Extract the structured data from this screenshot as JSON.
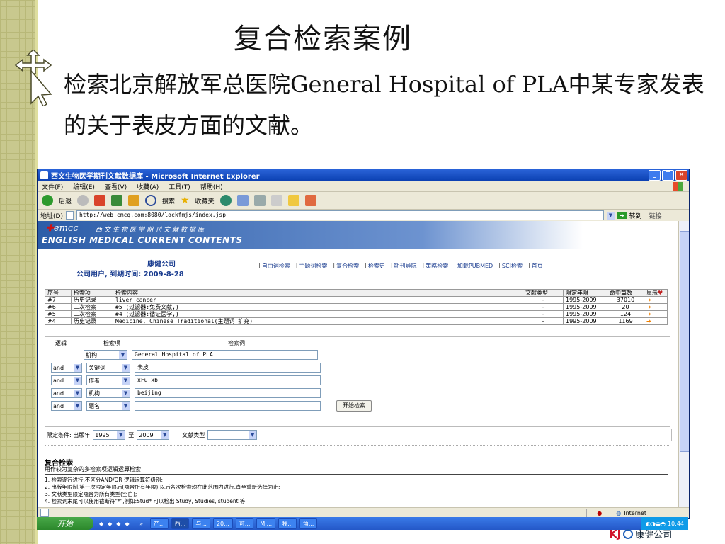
{
  "slide": {
    "title": "复合检索案例",
    "body": "检索北京解放军总医院General Hospital of PLA中某专家发表的关于表皮方面的文献。"
  },
  "browser": {
    "window_title": "西文生物医学期刊文献数据库 - Microsoft Internet Explorer",
    "menu": [
      "文件(F)",
      "编辑(E)",
      "查看(V)",
      "收藏(A)",
      "工具(T)",
      "帮助(H)"
    ],
    "toolbar": {
      "back": "后退",
      "search": "搜索",
      "favorites": "收藏夹"
    },
    "address_label": "地址(D)",
    "url": "http://web.cmcq.com:8080/lockfmjs/index.jsp",
    "go": "转到",
    "links": "链接"
  },
  "site": {
    "logo_emcc": "emcc",
    "logo_cn": "西文生物医学期刊文献数据库",
    "logo_en": "ENGLISH MEDICAL CURRENT CONTENTS",
    "company": "康健公司",
    "user_line": "公司用户, 到期时间: 2009-8-28",
    "nav": [
      "自由词检索",
      "主题词检索",
      "复合检索",
      "检索史",
      "期刊导航",
      "策略检索",
      "加载PUBMED",
      "SCI检索",
      "首页"
    ]
  },
  "history": {
    "headers": [
      "序号",
      "检索项",
      "检索内容",
      "文献类型",
      "限定年限",
      "命中篇数",
      "显示"
    ],
    "rows": [
      {
        "no": "#7",
        "item": "历史记录",
        "content": "liver cancer",
        "type": "-",
        "years": "1995-2009",
        "hits": "37010"
      },
      {
        "no": "#6",
        "item": "二次检索",
        "content": "#5   (过滤器:免费文献,)",
        "type": "-",
        "years": "1995-2009",
        "hits": "20"
      },
      {
        "no": "#5",
        "item": "二次检索",
        "content": "#4   (过滤器:循证医学,)",
        "type": "-",
        "years": "1995-2009",
        "hits": "124"
      },
      {
        "no": "#4",
        "item": "历史记录",
        "content": "Medicine, Chinese Traditional(主题词 扩充)",
        "type": "-",
        "years": "1995-2009",
        "hits": "1169"
      }
    ]
  },
  "form": {
    "h_logic": "逻辑",
    "h_field": "检索项",
    "h_term": "检索词",
    "rows": [
      {
        "logic": "",
        "field": "机构",
        "term": "General Hospital of PLA"
      },
      {
        "logic": "and",
        "field": "关键词",
        "term": "表皮"
      },
      {
        "logic": "and",
        "field": "作者",
        "term": "xFu xb"
      },
      {
        "logic": "and",
        "field": "机构",
        "term": "beijing"
      },
      {
        "logic": "and",
        "field": "题名",
        "term": ""
      }
    ],
    "start_button": "开始检索"
  },
  "limits": {
    "label": "限定条件: 出版年",
    "year_from": "1995",
    "to": "至",
    "year_to": "2009",
    "doc_type_label": "文献类型",
    "doc_type": ""
  },
  "help": {
    "title": "复合检索",
    "subtitle": "用作较为复杂的多检索项逻辑运算检索",
    "items": [
      "1. 检索逐行进行,不区分AND/OR 逻辑运算符级别;",
      "2. 出版年限制,第一次限定年限后(隐含所有年限),以后各次检索均在此范围内进行,直至重新选择为止;",
      "3. 文献类型限定隐含为所有类型(空白);",
      "4. 检索词末尾可以使用截断符\"*\",例如:Stud* 可以检出 Study, Studies, student 等."
    ]
  },
  "status": {
    "zone": "Internet"
  },
  "taskbar": {
    "start": "开始",
    "tasks": [
      "产...",
      "西...",
      "与...",
      "20...",
      "可...",
      "Mi...",
      "我...",
      "角..."
    ],
    "clock": "10:44"
  },
  "brand": {
    "logo_letters": "KJ",
    "name": "康健公司"
  }
}
